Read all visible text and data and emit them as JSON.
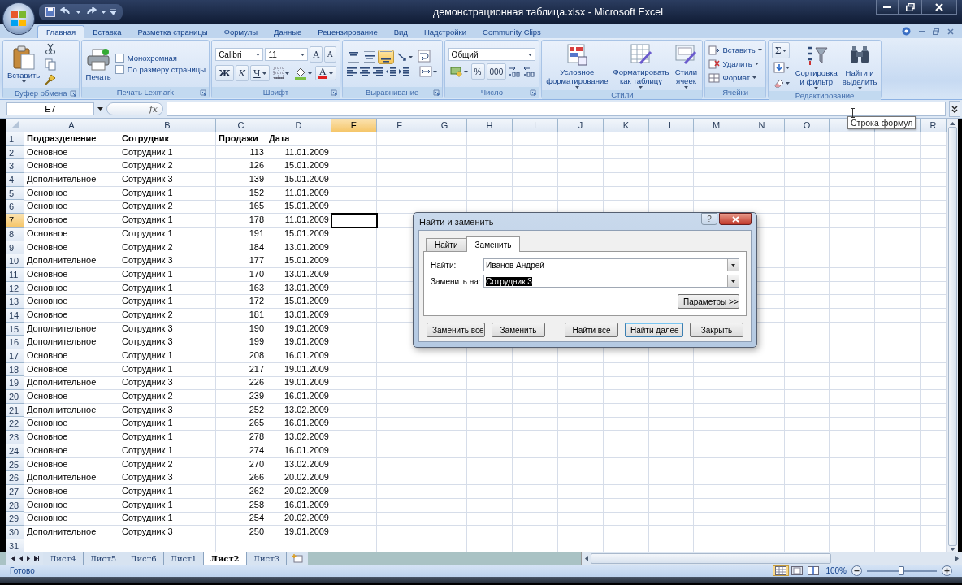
{
  "window": {
    "title": "демонстрационная таблица.xlsx - Microsoft Excel"
  },
  "ribbon_tabs": [
    {
      "label": "Главная",
      "selected": true
    },
    {
      "label": "Вставка",
      "selected": false
    },
    {
      "label": "Разметка страницы",
      "selected": false
    },
    {
      "label": "Формулы",
      "selected": false
    },
    {
      "label": "Данные",
      "selected": false
    },
    {
      "label": "Рецензирование",
      "selected": false
    },
    {
      "label": "Вид",
      "selected": false
    },
    {
      "label": "Надстройки",
      "selected": false
    },
    {
      "label": "Community Clips",
      "selected": false
    }
  ],
  "ribbon": {
    "groups": [
      {
        "label": "Буфер обмена",
        "launcher": true,
        "columns": [
          [
            [
              {
                "kind": "paste",
                "label": "Вставить",
                "menu": true
              }
            ]
          ],
          [
            [
              {
                "kind": "cut"
              }
            ],
            [
              {
                "kind": "copy"
              }
            ],
            [
              {
                "kind": "brush"
              }
            ]
          ]
        ]
      },
      {
        "label": "Печать Lexmark",
        "launcher": true,
        "columns": [
          [
            [
              {
                "kind": "printer",
                "label": "Печать"
              }
            ]
          ],
          [
            [
              {
                "kind": "checkbox",
                "label": "Монохромная",
                "checked": false
              }
            ],
            [
              {
                "kind": "checkbox",
                "label": "По размеру страницы",
                "checked": false
              }
            ]
          ]
        ]
      },
      {
        "label": "Шрифт",
        "launcher": true,
        "columns": [
          [
            [
              {
                "kind": "combo",
                "label": "Calibri"
              },
              {
                "kind": "combo",
                "label": "11"
              },
              {
                "kind": "grow",
                "label": "A"
              },
              {
                "kind": "shrink",
                "label": "A"
              }
            ],
            [
              {
                "kind": "bold",
                "label": "Ж"
              },
              {
                "kind": "italic",
                "label": "К"
              },
              {
                "kind": "underline",
                "label": "Ч",
                "menu": true
              },
              {
                "kind": "borders",
                "menu": true
              },
              {
                "kind": "fill",
                "menu": true
              },
              {
                "kind": "fontcolor",
                "label": "A",
                "menu": true
              }
            ]
          ]
        ]
      },
      {
        "label": "Выравнивание",
        "launcher": true,
        "columns": [
          [
            [
              {
                "kind": "aligntop",
                "selected": false
              },
              {
                "kind": "alignmiddle",
                "selected": false
              },
              {
                "kind": "alignbottom",
                "selected": true
              },
              {
                "kind": "orientation",
                "menu": true
              }
            ],
            [
              {
                "kind": "alignleft"
              },
              {
                "kind": "aligncenter"
              },
              {
                "kind": "alignright"
              },
              {
                "kind": "outdent"
              },
              {
                "kind": "indent"
              }
            ]
          ],
          [
            [
              {
                "kind": "wrap"
              }
            ],
            [
              {
                "kind": "merge",
                "menu": true
              }
            ]
          ]
        ]
      },
      {
        "label": "Число",
        "launcher": true,
        "columns": [
          [
            [
              {
                "kind": "combo",
                "label": "Общий"
              }
            ],
            [
              {
                "kind": "currency",
                "menu": true
              },
              {
                "kind": "percent",
                "label": "%"
              },
              {
                "kind": "thousands",
                "label": "000"
              },
              {
                "kind": "incdec"
              },
              {
                "kind": "decdec"
              }
            ]
          ]
        ]
      },
      {
        "label": "Стили",
        "columns": [
          [
            [
              {
                "kind": "cond",
                "label": "Условное\nформатирование",
                "menu": true
              }
            ]
          ],
          [
            [
              {
                "kind": "tablefmt",
                "label": "Форматировать\nкак таблицу",
                "menu": true
              }
            ]
          ],
          [
            [
              {
                "kind": "cellstyles",
                "label": "Стили\nячеек",
                "menu": true
              }
            ]
          ]
        ]
      },
      {
        "label": "Ячейки",
        "columns": [
          [
            [
              {
                "kind": "insertcells",
                "label": "Вставить",
                "menu": true
              }
            ],
            [
              {
                "kind": "deletecells",
                "label": "Удалить",
                "menu": true
              }
            ],
            [
              {
                "kind": "formatcells",
                "label": "Формат",
                "menu": true
              }
            ]
          ]
        ]
      },
      {
        "label": "Редактирование",
        "columns": [
          [
            [
              {
                "kind": "sum",
                "label": "Σ",
                "menu": true
              }
            ],
            [
              {
                "kind": "filldown",
                "menu": true
              }
            ],
            [
              {
                "kind": "clear",
                "menu": true
              }
            ]
          ],
          [
            [
              {
                "kind": "sort",
                "label": "Сортировка\nи фильтр",
                "menu": true
              }
            ]
          ],
          [
            [
              {
                "kind": "find",
                "label": "Найти и\nвыделить",
                "menu": true
              }
            ]
          ]
        ]
      }
    ]
  },
  "formula_bar": {
    "name_box": "E7",
    "fx": "fx",
    "tooltip": "Строка формул"
  },
  "sheet": {
    "columns": [
      {
        "label": "A",
        "selected": false
      },
      {
        "label": "B",
        "selected": false
      },
      {
        "label": "C",
        "selected": false
      },
      {
        "label": "D",
        "selected": false
      },
      {
        "label": "E",
        "selected": true
      },
      {
        "label": "F",
        "selected": false
      },
      {
        "label": "G",
        "selected": false
      },
      {
        "label": "H",
        "selected": false
      },
      {
        "label": "I",
        "selected": false
      },
      {
        "label": "J",
        "selected": false
      },
      {
        "label": "K",
        "selected": false
      },
      {
        "label": "L",
        "selected": false
      },
      {
        "label": "M",
        "selected": false
      },
      {
        "label": "N",
        "selected": false
      },
      {
        "label": "O",
        "selected": false
      },
      {
        "selected": false
      },
      {
        "selected": false
      },
      {
        "label": "R",
        "selected": false
      }
    ],
    "rows": [
      {
        "number": "1",
        "selected": false,
        "header": true,
        "cells": [
          "Подразделение",
          "Сотрудник",
          "Продажи",
          "Дата"
        ]
      },
      {
        "number": "2",
        "selected": false,
        "cells": [
          "Основное",
          "Сотрудник 1",
          "113",
          "11.01.2009"
        ]
      },
      {
        "number": "3",
        "selected": false,
        "cells": [
          "Основное",
          "Сотрудник 2",
          "126",
          "15.01.2009"
        ]
      },
      {
        "number": "4",
        "selected": false,
        "cells": [
          "Дополнительное",
          "Сотрудник 3",
          "139",
          "15.01.2009"
        ]
      },
      {
        "number": "5",
        "selected": false,
        "cells": [
          "Основное",
          "Сотрудник 1",
          "152",
          "11.01.2009"
        ]
      },
      {
        "number": "6",
        "selected": false,
        "cells": [
          "Основное",
          "Сотрудник 2",
          "165",
          "15.01.2009"
        ]
      },
      {
        "number": "7",
        "selected": true,
        "cells": [
          "Основное",
          "Сотрудник 1",
          "178",
          "11.01.2009"
        ]
      },
      {
        "number": "8",
        "selected": false,
        "cells": [
          "Основное",
          "Сотрудник 1",
          "191",
          "15.01.2009"
        ]
      },
      {
        "number": "9",
        "selected": false,
        "cells": [
          "Основное",
          "Сотрудник 2",
          "184",
          "13.01.2009"
        ]
      },
      {
        "number": "10",
        "selected": false,
        "cells": [
          "Дополнительное",
          "Сотрудник 3",
          "177",
          "15.01.2009"
        ]
      },
      {
        "number": "11",
        "selected": false,
        "cells": [
          "Основное",
          "Сотрудник 1",
          "170",
          "13.01.2009"
        ]
      },
      {
        "number": "12",
        "selected": false,
        "cells": [
          "Основное",
          "Сотрудник 1",
          "163",
          "13.01.2009"
        ]
      },
      {
        "number": "13",
        "selected": false,
        "cells": [
          "Основное",
          "Сотрудник 1",
          "172",
          "15.01.2009"
        ]
      },
      {
        "number": "14",
        "selected": false,
        "cells": [
          "Основное",
          "Сотрудник 2",
          "181",
          "13.01.2009"
        ]
      },
      {
        "number": "15",
        "selected": false,
        "cells": [
          "Дополнительное",
          "Сотрудник 3",
          "190",
          "19.01.2009"
        ]
      },
      {
        "number": "16",
        "selected": false,
        "cells": [
          "Дополнительное",
          "Сотрудник 3",
          "199",
          "19.01.2009"
        ]
      },
      {
        "number": "17",
        "selected": false,
        "cells": [
          "Основное",
          "Сотрудник 1",
          "208",
          "16.01.2009"
        ]
      },
      {
        "number": "18",
        "selected": false,
        "cells": [
          "Основное",
          "Сотрудник 1",
          "217",
          "19.01.2009"
        ]
      },
      {
        "number": "19",
        "selected": false,
        "cells": [
          "Дополнительное",
          "Сотрудник 3",
          "226",
          "19.01.2009"
        ]
      },
      {
        "number": "20",
        "selected": false,
        "cells": [
          "Основное",
          "Сотрудник 2",
          "239",
          "16.01.2009"
        ]
      },
      {
        "number": "21",
        "selected": false,
        "cells": [
          "Дополнительное",
          "Сотрудник 3",
          "252",
          "13.02.2009"
        ]
      },
      {
        "number": "22",
        "selected": false,
        "cells": [
          "Основное",
          "Сотрудник 1",
          "265",
          "16.01.2009"
        ]
      },
      {
        "number": "23",
        "selected": false,
        "cells": [
          "Основное",
          "Сотрудник 1",
          "278",
          "13.02.2009"
        ]
      },
      {
        "number": "24",
        "selected": false,
        "cells": [
          "Основное",
          "Сотрудник 1",
          "274",
          "16.01.2009"
        ]
      },
      {
        "number": "25",
        "selected": false,
        "cells": [
          "Основное",
          "Сотрудник 2",
          "270",
          "13.02.2009"
        ]
      },
      {
        "number": "26",
        "selected": false,
        "cells": [
          "Дополнительное",
          "Сотрудник 3",
          "266",
          "20.02.2009"
        ]
      },
      {
        "number": "27",
        "selected": false,
        "cells": [
          "Основное",
          "Сотрудник 1",
          "262",
          "20.02.2009"
        ]
      },
      {
        "number": "28",
        "selected": false,
        "cells": [
          "Основное",
          "Сотрудник 1",
          "258",
          "16.01.2009"
        ]
      },
      {
        "number": "29",
        "selected": false,
        "cells": [
          "Основное",
          "Сотрудник 1",
          "254",
          "20.02.2009"
        ]
      },
      {
        "number": "30",
        "selected": false,
        "cells": [
          "Дополнительное",
          "Сотрудник 3",
          "250",
          "19.01.2009"
        ]
      },
      {
        "number": "31",
        "selected": false
      }
    ]
  },
  "dialog": {
    "title": "Найти и заменить",
    "help": "?",
    "tabs": [
      {
        "label": "Найти",
        "selected": false
      },
      {
        "label": "Заменить",
        "selected": true
      }
    ],
    "fields": [
      {
        "label": "Найти:",
        "value": "Иванов Андрей",
        "selected": false
      },
      {
        "label": "Заменить на:",
        "value": "Сотрудник 3",
        "selected": true
      }
    ],
    "options_button": "Параметры >>",
    "buttons": [
      {
        "label": "Заменить все",
        "focused": false
      },
      {
        "label": "Заменить",
        "focused": false
      },
      {
        "label": "Найти все",
        "focused": false
      },
      {
        "label": "Найти далее",
        "focused": true
      },
      {
        "label": "Закрыть",
        "focused": false
      }
    ]
  },
  "sheet_tabs": [
    {
      "label": "Лист4",
      "selected": false
    },
    {
      "label": "Лист5",
      "selected": false
    },
    {
      "label": "Лист6",
      "selected": false
    },
    {
      "label": "Лист1",
      "selected": false
    },
    {
      "label": "Лист2",
      "selected": true
    },
    {
      "label": "Лист3",
      "selected": false
    }
  ],
  "status_bar": {
    "status": "Готово",
    "views": [
      {
        "kind": "normal",
        "selected": true
      },
      {
        "kind": "layout",
        "selected": false
      },
      {
        "kind": "pagebreak",
        "selected": false
      }
    ],
    "zoom": "100%",
    "level": 0.5
  }
}
